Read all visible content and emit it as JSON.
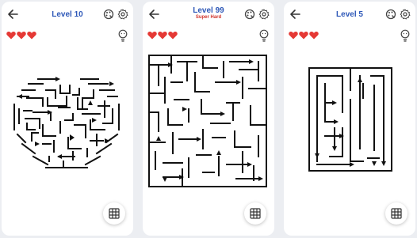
{
  "screens": [
    {
      "level_title": "Level 10",
      "hearts": 3,
      "maze_shape": "heart"
    },
    {
      "level_title": "Level 99",
      "level_subtitle": "Super Hard",
      "hearts": 3,
      "maze_shape": "square"
    },
    {
      "level_title": "Level 5",
      "hearts": 3,
      "maze_shape": "rectangle"
    }
  ],
  "icons": {
    "back": "back-arrow-icon",
    "theme": "palette-icon",
    "settings": "gear-icon",
    "life": "heart-icon",
    "hint": "lightbulb-icon",
    "level_grid": "grid-icon"
  },
  "colors": {
    "title": "#2e58b8",
    "subtitle": "#d0342c",
    "heart": "#e53935",
    "maze_line": "#111111"
  }
}
